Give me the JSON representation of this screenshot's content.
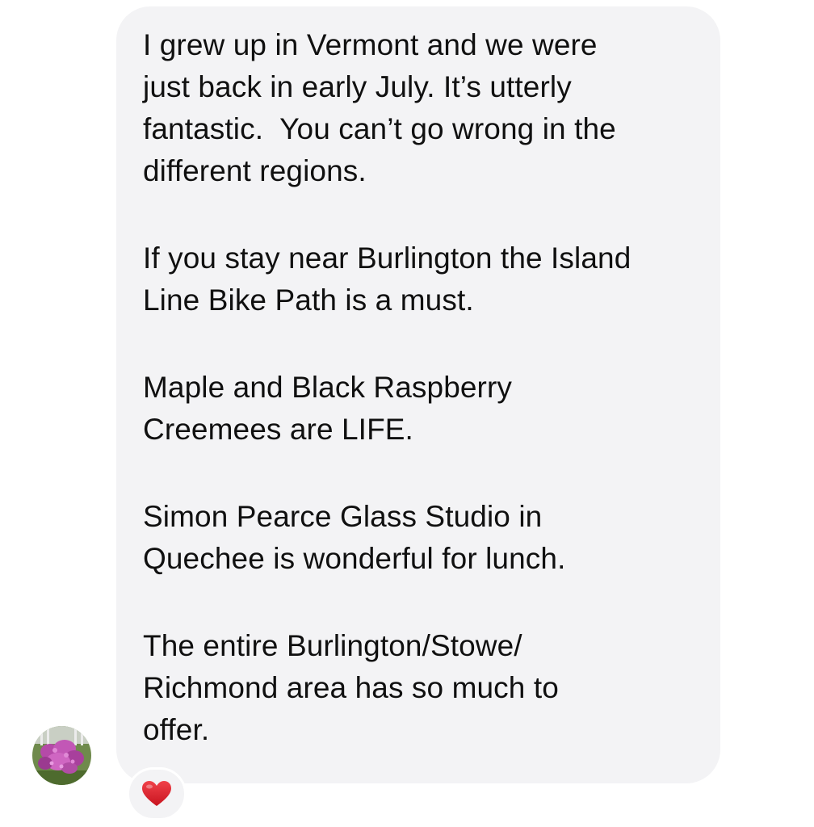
{
  "message": {
    "paragraphs": [
      "I grew up in Vermont and we were\njust back in early July. It’s utterly\nfantastic.  You can’t go wrong in the\ndifferent regions.",
      "If you stay near Burlington the Island\nLine Bike Path is a must.",
      "Maple and Black Raspberry\nCreemees are LIFE.",
      "Simon Pearce Glass Studio in\nQuechee is wonderful for lunch.",
      "The entire Burlington/Stowe/\nRichmond area has so much to\noffer."
    ]
  },
  "sender": {
    "avatar_icon": "flower-photo-avatar"
  },
  "reaction": {
    "icon": "red-heart-icon",
    "color": "#e0242f"
  },
  "colors": {
    "bubble_background": "#f3f3f5",
    "text": "#101010",
    "page_background": "#ffffff"
  }
}
